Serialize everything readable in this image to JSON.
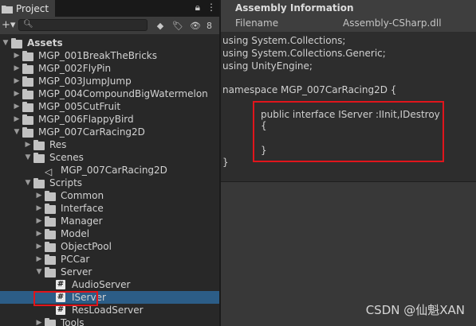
{
  "project_panel": {
    "tab_label": "Project",
    "hidden_count": "8",
    "search": {
      "value": "",
      "placeholder": ""
    },
    "tree": [
      {
        "label": "Assets",
        "kind": "folder",
        "expanded": true,
        "depth": 0
      },
      {
        "label": "MGP_001BreakTheBricks",
        "kind": "folder",
        "expanded": false,
        "depth": 1
      },
      {
        "label": "MGP_002FlyPin",
        "kind": "folder",
        "expanded": false,
        "depth": 1
      },
      {
        "label": "MGP_003JumpJump",
        "kind": "folder",
        "expanded": false,
        "depth": 1
      },
      {
        "label": "MGP_004CompoundBigWatermelon",
        "kind": "folder",
        "expanded": false,
        "depth": 1
      },
      {
        "label": "MGP_005CutFruit",
        "kind": "folder",
        "expanded": false,
        "depth": 1
      },
      {
        "label": "MGP_006FlappyBird",
        "kind": "folder",
        "expanded": false,
        "depth": 1
      },
      {
        "label": "MGP_007CarRacing2D",
        "kind": "folder",
        "expanded": true,
        "depth": 1
      },
      {
        "label": "Res",
        "kind": "folder",
        "expanded": false,
        "depth": 2
      },
      {
        "label": "Scenes",
        "kind": "folder",
        "expanded": true,
        "depth": 2
      },
      {
        "label": "MGP_007CarRacing2D",
        "kind": "scene",
        "depth": 3
      },
      {
        "label": "Scripts",
        "kind": "folder",
        "expanded": true,
        "depth": 2
      },
      {
        "label": "Common",
        "kind": "folder",
        "expanded": false,
        "depth": 3
      },
      {
        "label": "Interface",
        "kind": "folder",
        "expanded": false,
        "depth": 3
      },
      {
        "label": "Manager",
        "kind": "folder",
        "expanded": false,
        "depth": 3
      },
      {
        "label": "Model",
        "kind": "folder",
        "expanded": false,
        "depth": 3
      },
      {
        "label": "ObjectPool",
        "kind": "folder",
        "expanded": false,
        "depth": 3
      },
      {
        "label": "PCCar",
        "kind": "folder",
        "expanded": false,
        "depth": 3
      },
      {
        "label": "Server",
        "kind": "folder",
        "expanded": true,
        "depth": 3
      },
      {
        "label": "AudioServer",
        "kind": "script",
        "depth": 4
      },
      {
        "label": "IServer",
        "kind": "script",
        "depth": 4,
        "selected": true
      },
      {
        "label": "ResLoadServer",
        "kind": "script",
        "depth": 4
      },
      {
        "label": "Tools",
        "kind": "folder",
        "expanded": false,
        "depth": 3
      }
    ]
  },
  "inspector": {
    "title": "Assembly Information",
    "filename_label": "Filename",
    "filename_value": "Assembly-CSharp.dll",
    "code_lines": [
      "using System.Collections;",
      "using System.Collections.Generic;",
      "using UnityEngine;",
      "",
      "namespace MGP_007CarRacing2D {",
      "",
      "public interface IServer :IInit,IDestroy",
      "{",
      "",
      "}",
      "}"
    ]
  },
  "watermark": "CSDN @仙魁XAN",
  "colors": {
    "selection": "#2c5d87",
    "highlight_border": "#e0151c",
    "panel_bg": "#282828",
    "inspector_bg": "#383838"
  }
}
